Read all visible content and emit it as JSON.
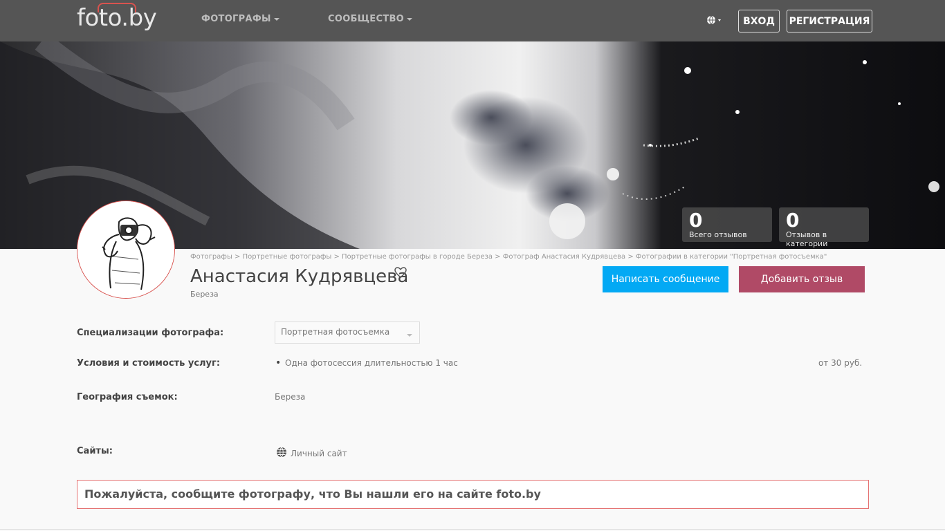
{
  "header": {
    "logo": "foto.by",
    "nav": [
      {
        "label": "ФОТОГРАФЫ"
      },
      {
        "label": "СООБЩЕСТВО"
      }
    ],
    "login_label": "ВХОД",
    "register_label": "РЕГИСТРАЦИЯ"
  },
  "stats": [
    {
      "value": "0",
      "label": "Всего отзывов"
    },
    {
      "value": "0",
      "label": "Отзывов в категории"
    }
  ],
  "breadcrumb": "Фотографы > Портретные фотографы > Портретные фотографы в городе Береза > Фотограф Анастасия Кудрявцева > Фотографии в категории \"Портретная фотосъемка\"",
  "profile": {
    "name": "Анастасия Кудрявцева",
    "city": "Береза",
    "message_button": "Написать сообщение",
    "review_button": "Добавить отзыв"
  },
  "details": {
    "specializations_label": "Специализации фотографа:",
    "specialization_selected": "Портретная фотосъемка",
    "conditions_label": "Условия и стоимость услуг:",
    "service": "Одна фотосессия длительностью 1 час",
    "price": "от 30 руб.",
    "geography_label": "География съемок:",
    "geography": "Береза",
    "sites_label": "Сайты:",
    "site": "Личный сайт"
  },
  "notice": "Пожалуйста, сообщите фотографу, что Вы нашли его на сайте foto.by",
  "colors": {
    "topbar": "#555555",
    "blue_button": "#03a9f4",
    "red_button": "#b04a66",
    "accent_red": "#d9534f"
  }
}
